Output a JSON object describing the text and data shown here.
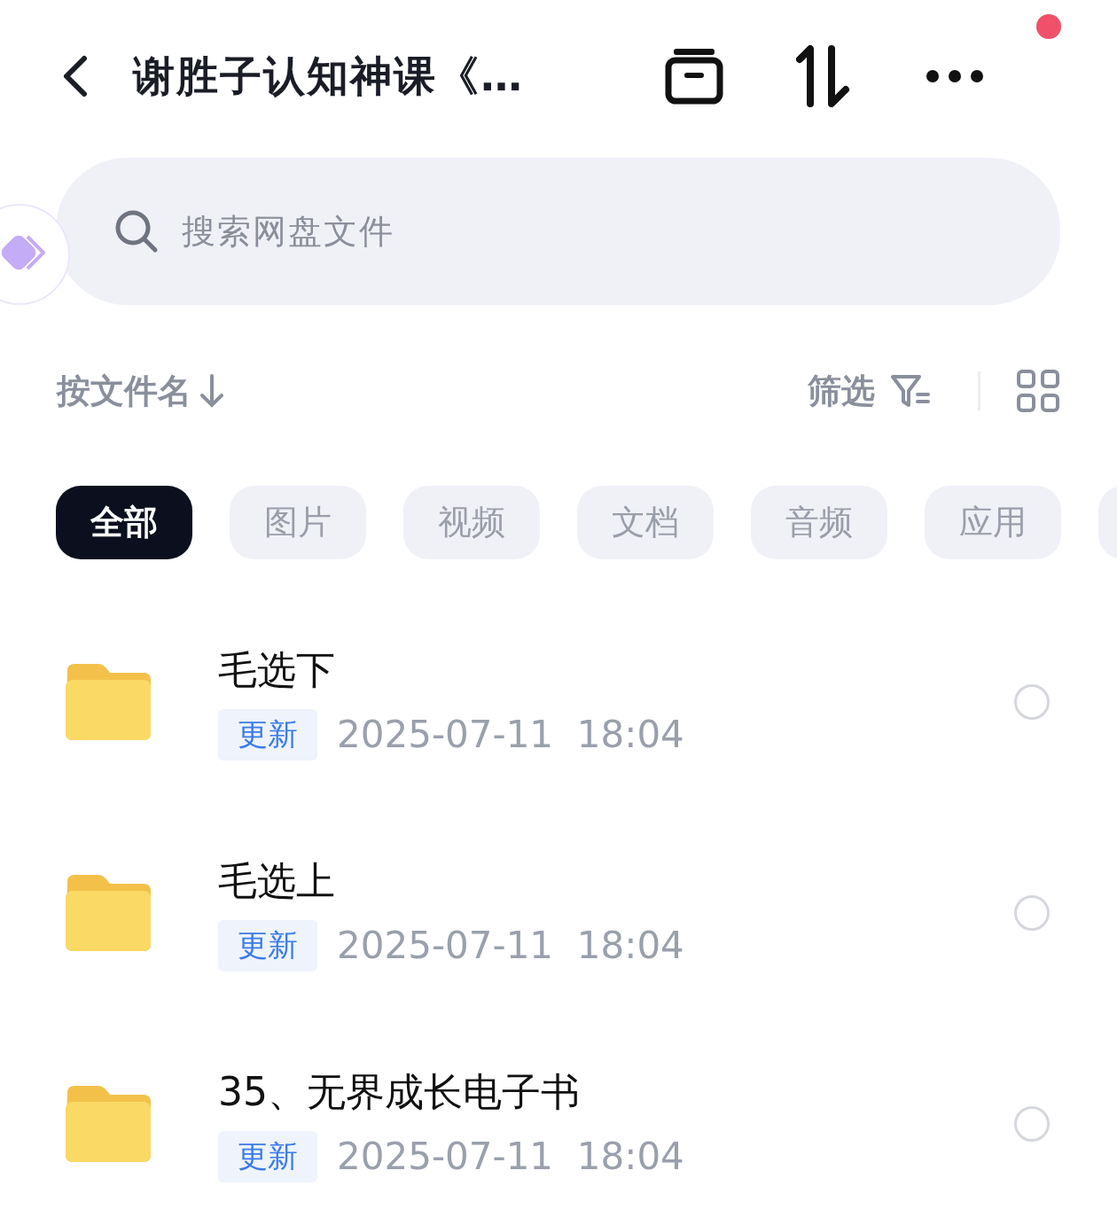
{
  "header": {
    "title": "谢胜子认知神课《…",
    "notification_dot": true
  },
  "search": {
    "placeholder": "搜索网盘文件"
  },
  "sort": {
    "label": "按文件名",
    "filter_label": "筛选"
  },
  "chips": [
    {
      "label": "全部",
      "selected": true
    },
    {
      "label": "图片",
      "selected": false
    },
    {
      "label": "视频",
      "selected": false
    },
    {
      "label": "文档",
      "selected": false
    },
    {
      "label": "音频",
      "selected": false
    },
    {
      "label": "应用",
      "selected": false
    }
  ],
  "files": [
    {
      "name": "毛选下",
      "tag": "更新",
      "date": "2025-07-11",
      "time": "18:04",
      "checked": false
    },
    {
      "name": "毛选上",
      "tag": "更新",
      "date": "2025-07-11",
      "time": "18:04",
      "checked": false
    },
    {
      "name": "35、无界成长电子书",
      "tag": "更新",
      "date": "2025-07-11",
      "time": "18:04",
      "checked": false
    }
  ]
}
